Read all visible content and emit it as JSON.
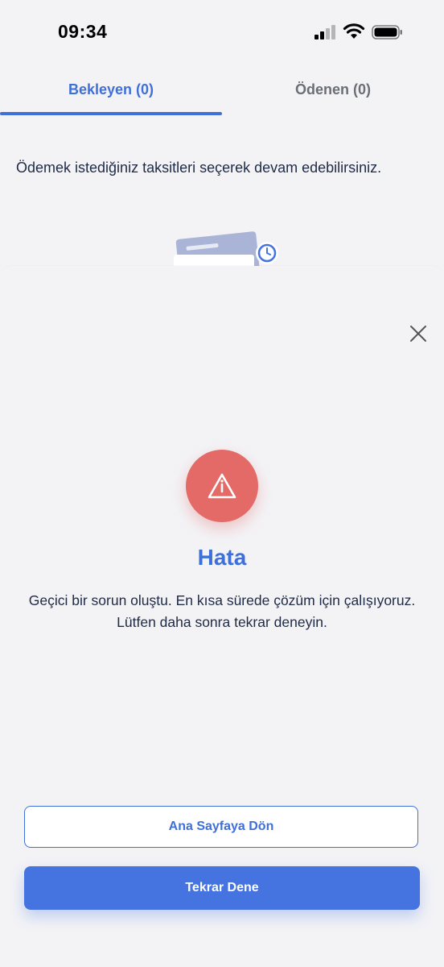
{
  "status_bar": {
    "time": "09:34"
  },
  "tabs": [
    {
      "label": "Bekleyen (0)",
      "active": true
    },
    {
      "label": "Ödenen (0)",
      "active": false
    }
  ],
  "info_text": "Ödemek istediğiniz taksitleri seçerek devam edebilirsiniz.",
  "sheet": {
    "icon": "warning-icon",
    "title": "Hata",
    "message_line1": "Geçici bir sorun oluştu. En kısa sürede çözüm için çalışıyoruz.",
    "message_line2": "Lütfen daha sonra tekrar deneyin.",
    "secondary_button": "Ana Sayfaya Dön",
    "primary_button": "Tekrar Dene"
  },
  "colors": {
    "accent": "#3f6fd8",
    "error": "#e46a67",
    "primary_button": "#4574e0"
  }
}
